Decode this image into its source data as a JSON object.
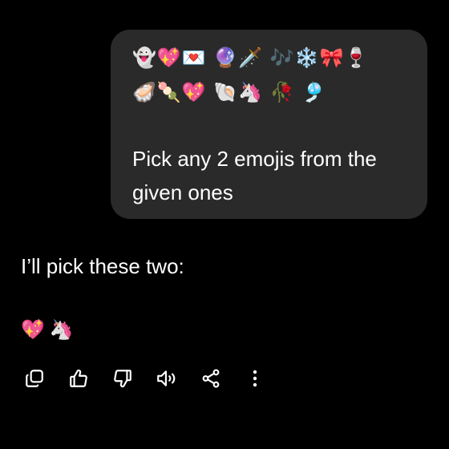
{
  "user_message": {
    "emoji_row_1": "👻💖💌 🔮🗡️ 🎶❄️🎀🍷",
    "emoji_row_2": "🦪🍡💖 🐚🦄 🥀 🎐",
    "text": "Pick any 2 emojis from the given ones"
  },
  "assistant_message": {
    "text": "I’ll pick these two:",
    "emojis": "💖🦄"
  },
  "actions": [
    {
      "icon": "copy-icon"
    },
    {
      "icon": "thumbs-up-icon"
    },
    {
      "icon": "thumbs-down-icon"
    },
    {
      "icon": "speaker-icon"
    },
    {
      "icon": "share-icon"
    },
    {
      "icon": "more-vertical-icon"
    }
  ],
  "colors": {
    "background": "#000000",
    "bubble": "#2a2a2a",
    "text": "#ffffff"
  }
}
